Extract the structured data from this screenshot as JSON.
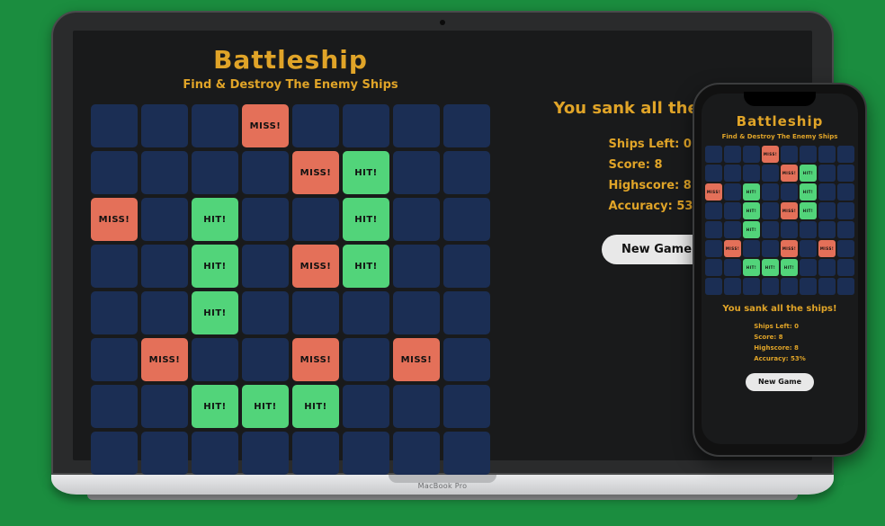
{
  "title": "Battleship",
  "subtitle": "Find & Destroy The Enemy Ships",
  "labels": {
    "hit": "HIT!",
    "miss": "MISS!",
    "new_game": "New Game"
  },
  "status_message": "You sank all the ships!",
  "stats": {
    "ships_left_label": "Ships Left:",
    "ships_left_value": "0",
    "score_label": "Score:",
    "score_value": "8",
    "highscore_label": "Highscore:",
    "highscore_value": "8",
    "accuracy_label": "Accuracy:",
    "accuracy_value": "53%"
  },
  "board": {
    "rows": 8,
    "cols": 8,
    "cells": [
      [
        "",
        "",
        "",
        "miss",
        "",
        "",
        "",
        ""
      ],
      [
        "",
        "",
        "",
        "",
        "miss",
        "hit",
        "",
        ""
      ],
      [
        "miss",
        "",
        "hit",
        "",
        "",
        "hit",
        "",
        ""
      ],
      [
        "",
        "",
        "hit",
        "",
        "miss",
        "hit",
        "",
        ""
      ],
      [
        "",
        "",
        "hit",
        "",
        "",
        "",
        "",
        ""
      ],
      [
        "",
        "miss",
        "",
        "",
        "miss",
        "",
        "miss",
        ""
      ],
      [
        "",
        "",
        "hit",
        "hit",
        "hit",
        "",
        "",
        ""
      ],
      [
        "",
        "",
        "",
        "",
        "",
        "",
        "",
        ""
      ]
    ]
  },
  "laptop_brand": "MacBook Pro",
  "colors": {
    "background": "#191a1b",
    "cell_default": "#1b2e54",
    "cell_hit": "#52d47a",
    "cell_miss": "#e47059",
    "accent": "#e0a428"
  }
}
